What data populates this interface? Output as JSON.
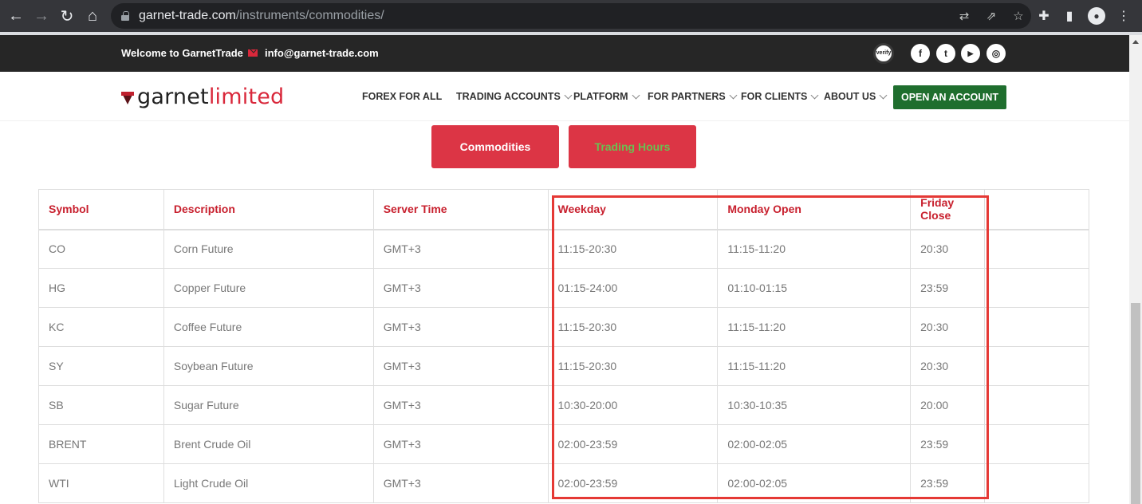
{
  "browser": {
    "url_domain": "garnet-trade.com",
    "url_path": "/instruments/commodities/",
    "icons": [
      "back-icon",
      "forward-icon",
      "reload-icon",
      "home-icon",
      "lock-icon",
      "translate-icon",
      "share-icon",
      "bookmark-star-icon",
      "extensions-icon",
      "side-panel-icon",
      "profile-icon",
      "menu-icon"
    ]
  },
  "topbar": {
    "welcome": "Welcome to GarnetTrade",
    "email": "info@garnet-trade.com",
    "verify_badge": "verify",
    "social": [
      "f",
      "t",
      "▶",
      "◎"
    ]
  },
  "header": {
    "logo_part1": "garnet",
    "logo_part2": "limited",
    "nav": [
      {
        "label": "FOREX FOR ALL",
        "dropdown": false
      },
      {
        "label": "TRADING ACCOUNTS",
        "dropdown": true
      },
      {
        "label": "PLATFORM",
        "dropdown": true
      },
      {
        "label": "FOR PARTNERS",
        "dropdown": true
      },
      {
        "label": "FOR CLIENTS",
        "dropdown": true
      },
      {
        "label": "ABOUT US",
        "dropdown": true
      }
    ],
    "cta": "OPEN AN ACCOUNT",
    "cta_color": "#1f6e2e"
  },
  "tabs": [
    {
      "label": "Commodities",
      "active": false
    },
    {
      "label": "Trading Hours",
      "active": true
    }
  ],
  "table": {
    "columns": [
      "Symbol",
      "Description",
      "Server Time",
      "Weekday",
      "Monday Open",
      "Friday Close",
      ""
    ],
    "rows": [
      [
        "CO",
        "Corn Future",
        "GMT+3",
        "11:15-20:30",
        "11:15-11:20",
        "20:30",
        ""
      ],
      [
        "HG",
        "Copper Future",
        "GMT+3",
        "01:15-24:00",
        "01:10-01:15",
        "23:59",
        ""
      ],
      [
        "KC",
        "Coffee Future",
        "GMT+3",
        "11:15-20:30",
        "11:15-11:20",
        "20:30",
        ""
      ],
      [
        "SY",
        "Soybean Future",
        "GMT+3",
        "11:15-20:30",
        "11:15-11:20",
        "20:30",
        ""
      ],
      [
        "SB",
        "Sugar Future",
        "GMT+3",
        "10:30-20:00",
        "10:30-10:35",
        "20:00",
        ""
      ],
      [
        "BRENT",
        "Brent Crude Oil",
        "GMT+3",
        "02:00-23:59",
        "02:00-02:05",
        "23:59",
        ""
      ],
      [
        "WTI",
        "Light Crude Oil",
        "GMT+3",
        "02:00-23:59",
        "02:00-02:05",
        "23:59",
        ""
      ]
    ]
  },
  "colors": {
    "brand_red": "#dc3545",
    "header_text_red": "#c8202e",
    "highlight_box": "#e53935"
  }
}
